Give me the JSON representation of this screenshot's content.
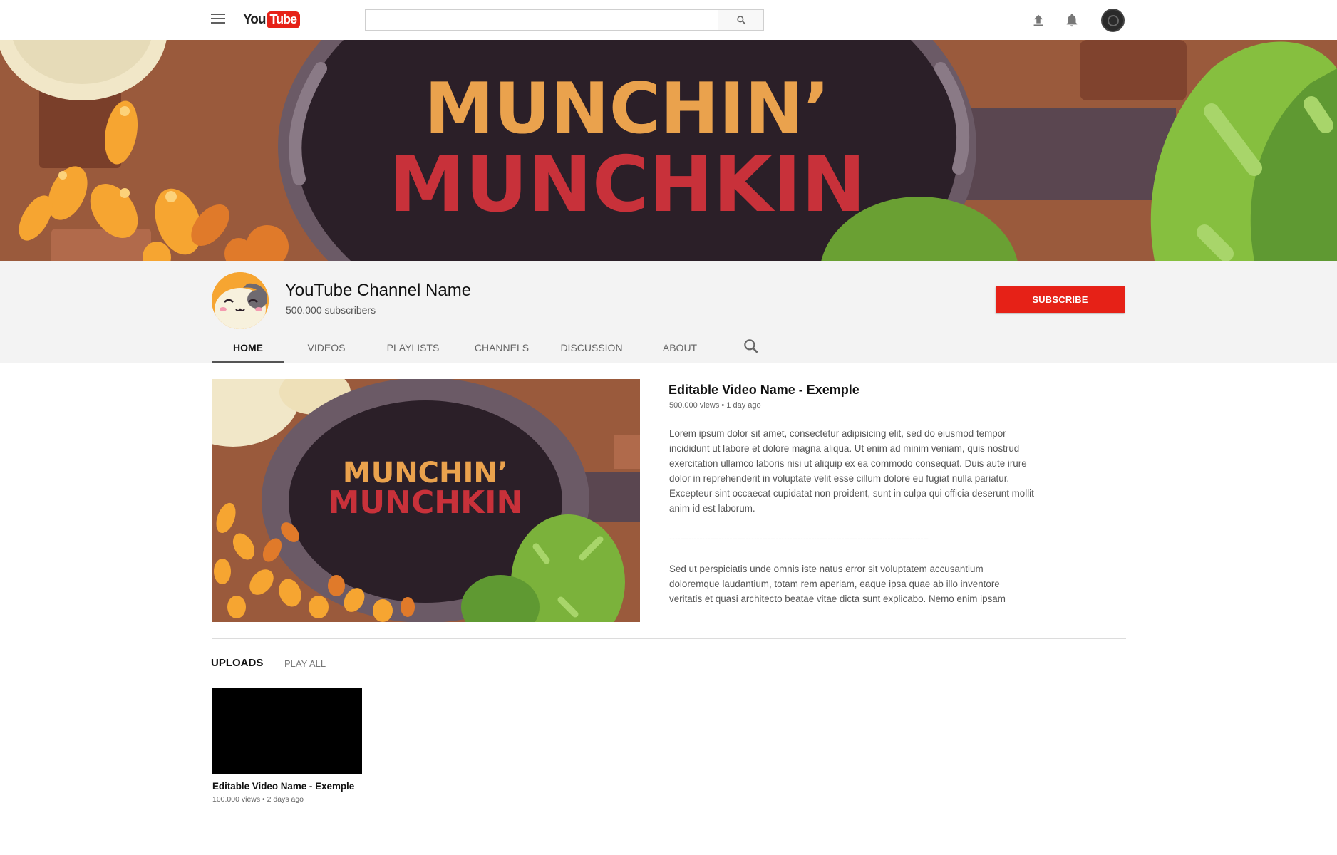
{
  "topbar": {
    "logo_you": "You",
    "logo_tube": "Tube",
    "search_value": ""
  },
  "banner": {
    "title_line1": "MUNCHIN’",
    "title_line2": "MUNCHKIN"
  },
  "channel": {
    "name": "YouTube Channel Name",
    "subscribers": "500.000 subscribers",
    "subscribe_label": "SUBSCRIBE"
  },
  "tabs": [
    {
      "label": "HOME",
      "active": true
    },
    {
      "label": "VIDEOS",
      "active": false
    },
    {
      "label": "PLAYLISTS",
      "active": false
    },
    {
      "label": "CHANNELS",
      "active": false
    },
    {
      "label": "DISCUSSION",
      "active": false
    },
    {
      "label": "ABOUT",
      "active": false
    }
  ],
  "featured": {
    "thumb_line1": "MUNCHIN’",
    "thumb_line2": "MUNCHKIN",
    "title": "Editable Video Name - Exemple",
    "meta": "500.000 views • 1 day ago",
    "description": "Lorem ipsum dolor sit amet, consectetur adipisicing elit, sed do eiusmod tempor incididunt ut labore et dolore magna aliqua. Ut enim ad minim veniam, quis nostrud exercitation ullamco laboris nisi ut aliquip ex ea commodo consequat. Duis aute irure dolor in reprehenderit in voluptate velit esse cillum dolore eu fugiat nulla pariatur. Excepteur sint occaecat cupidatat non proident, sunt in culpa qui officia deserunt mollit anim id est laborum.",
    "divider": "-----------------------------------------------------------------------------------------------",
    "description2": "Sed ut perspiciatis unde omnis iste natus error sit voluptatem accusantium doloremque laudantium, totam rem aperiam, eaque ipsa quae ab illo inventore veritatis et quasi architecto beatae vitae dicta sunt explicabo. Nemo enim ipsam"
  },
  "uploads": {
    "title": "UPLOADS",
    "play_all": "PLAY ALL",
    "items": [
      {
        "title": "Editable Video Name - Exemple",
        "meta": "100.000 views • 2 days ago"
      }
    ]
  },
  "colors": {
    "brand_red": "#e62117",
    "banner_brown": "#9a5a3c",
    "pan_dark": "#2b1f28",
    "title_orange": "#eaa24d",
    "title_red": "#c8313a",
    "leaf_green": "#7bb23b"
  }
}
